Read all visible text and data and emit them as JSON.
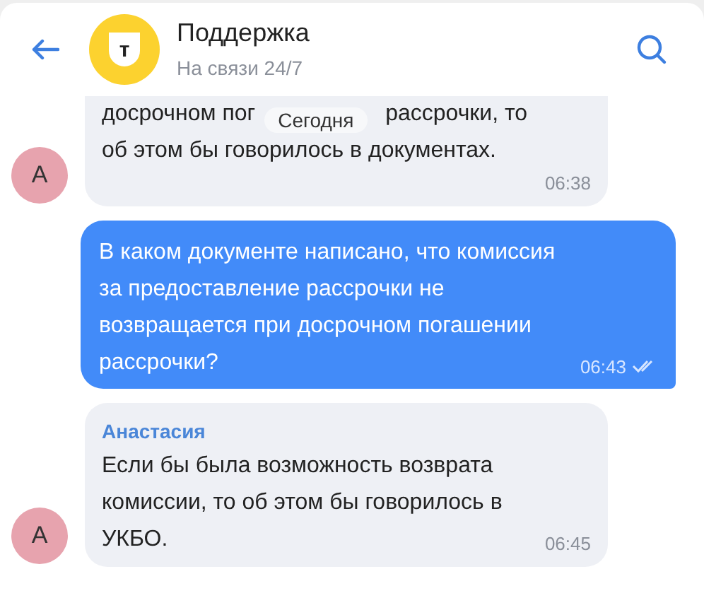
{
  "header": {
    "title": "Поддержка",
    "status": "На связи 24/7",
    "logo_letter": "т"
  },
  "date_chip": "Сегодня",
  "messages": [
    {
      "kind": "incoming",
      "cut_top": true,
      "avatar": "А",
      "fragments": [
        [
          "досрочном пог",
          "рассрочки, то"
        ],
        [
          "об этом бы говорилось в документах."
        ]
      ],
      "time": "06:38"
    },
    {
      "kind": "outgoing",
      "lines": [
        "В каком документе написано, что комиссия",
        "за предоставление рассрочки не",
        "возвращается при досрочном погашении",
        "рассрочки?"
      ],
      "time": "06:43",
      "read": true
    },
    {
      "kind": "incoming",
      "author": "Анастасия",
      "avatar": "А",
      "lines": [
        "Если бы была возможность возврата",
        "комиссии, то об этом бы говорилось в",
        "УКБО."
      ],
      "time": "06:45"
    }
  ]
}
